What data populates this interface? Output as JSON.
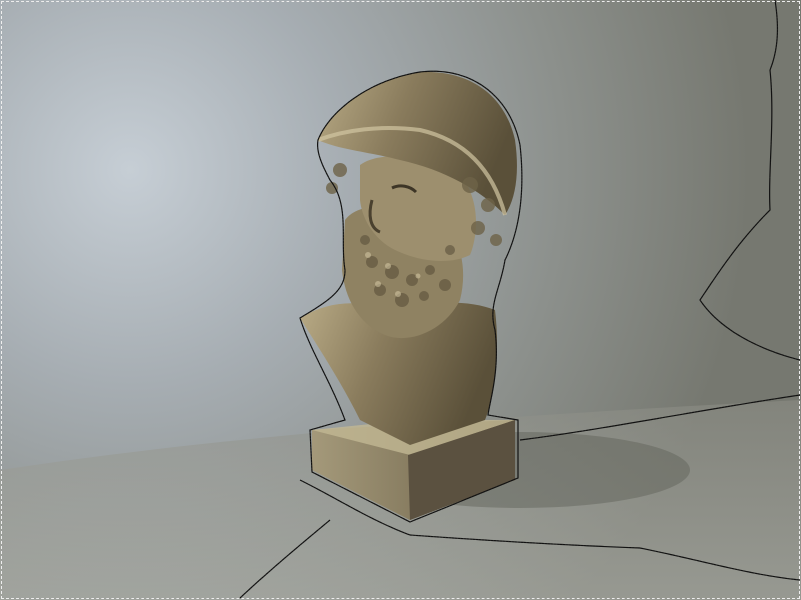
{
  "document": {
    "content": "bust-photograph",
    "selection": "magic-wand-marquee"
  },
  "colors": {
    "background_light": "#c4ccd3",
    "background_dark": "#7c7f78",
    "bust": "#8a7c5e",
    "bust_highlight": "#c8bb98",
    "bust_shadow": "#4f4634",
    "marquee_dark": "#1a1a1a",
    "marquee_light": "#f2f2f2"
  }
}
